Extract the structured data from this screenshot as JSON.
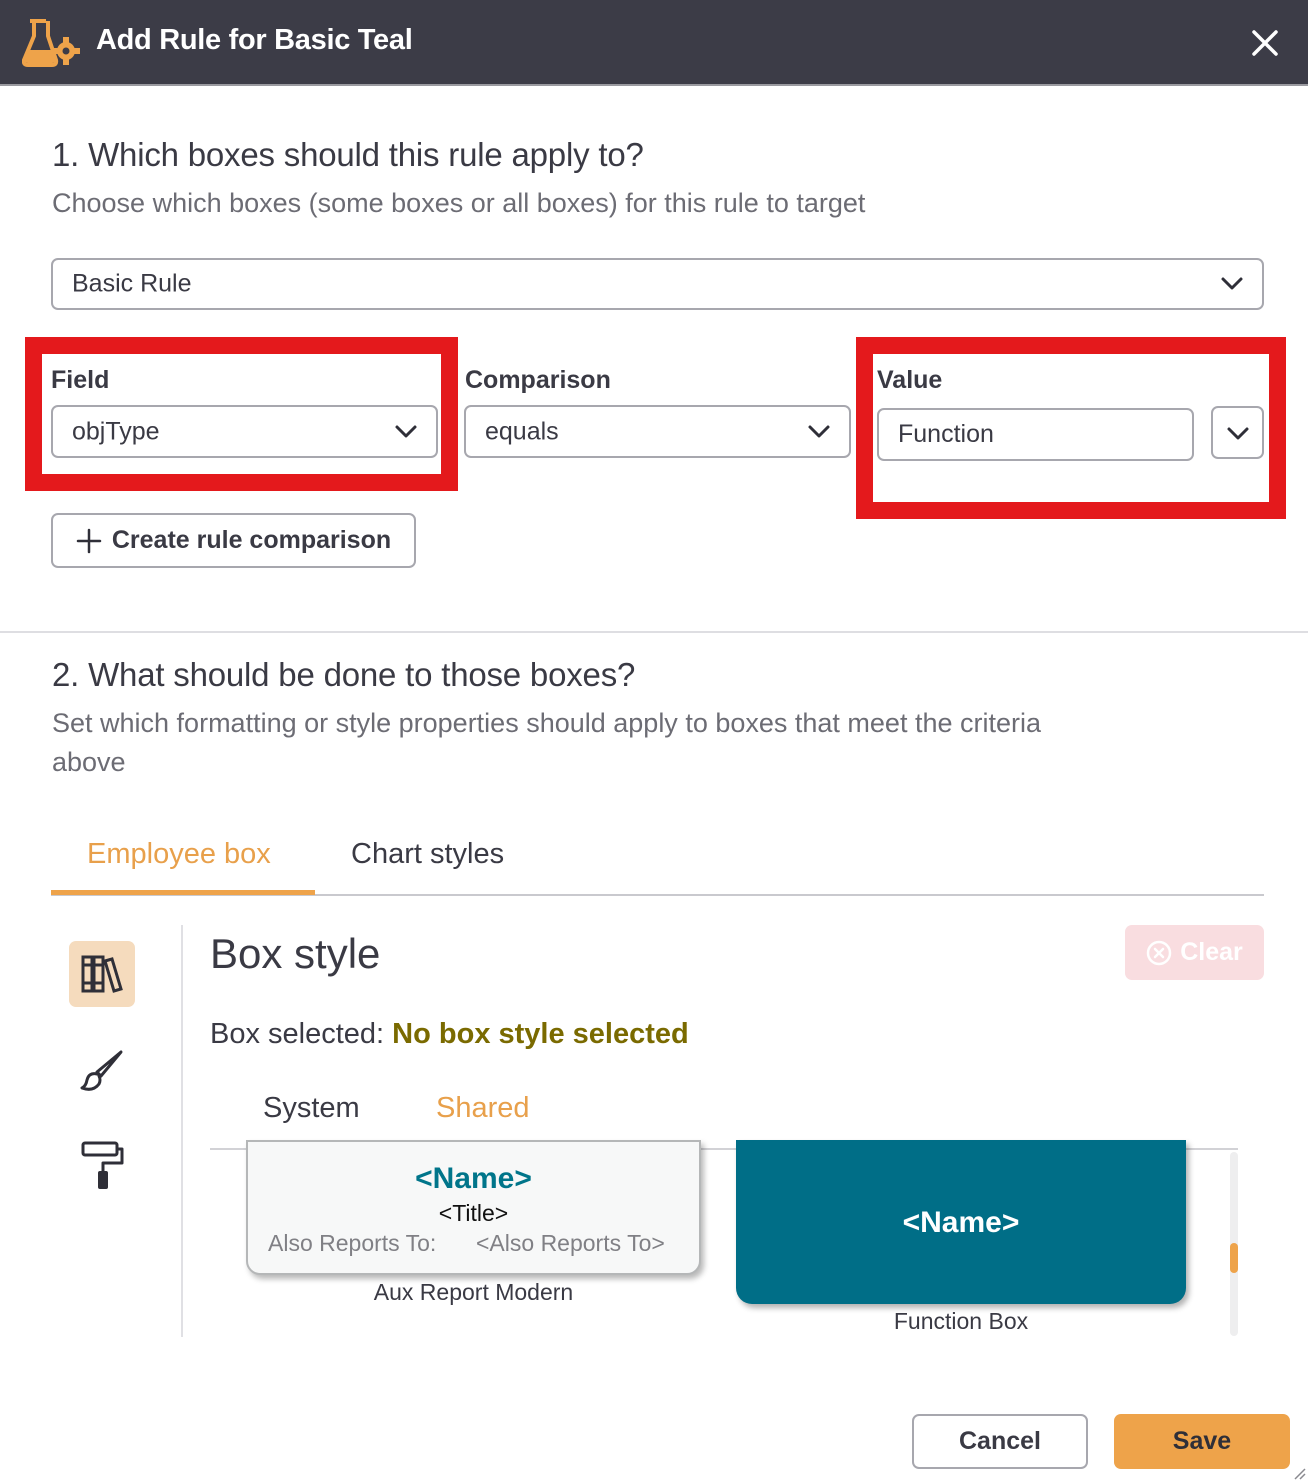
{
  "header": {
    "title": "Add Rule for Basic Teal",
    "icon": "flask-gear-icon",
    "close_icon": "close-icon"
  },
  "section1": {
    "title": "1. Which boxes should this rule apply to?",
    "subtitle": "Choose which boxes (some boxes or all boxes) for this rule to target",
    "rule_type": "Basic Rule",
    "field": {
      "label": "Field",
      "value": "objType"
    },
    "comparison": {
      "label": "Comparison",
      "value": "equals"
    },
    "value": {
      "label": "Value",
      "input": "Function"
    },
    "create_button": "Create rule comparison"
  },
  "section2": {
    "title": "2. What should be done to those boxes?",
    "subtitle_line1": "Set which formatting or style properties should apply to boxes that meet the criteria",
    "subtitle_line2": "above",
    "tabs": [
      {
        "label": "Employee box",
        "active": true
      },
      {
        "label": "Chart styles",
        "active": false
      }
    ]
  },
  "box_style": {
    "title": "Box style",
    "clear_label": "Clear",
    "selected_label": "Box selected:",
    "selected_value": "No box style selected",
    "subtabs": [
      {
        "label": "System",
        "active": false
      },
      {
        "label": "Shared",
        "active": true
      }
    ],
    "cards": [
      {
        "name": "<Name>",
        "title": "<Title>",
        "also_label": "Also Reports To:",
        "also_value": "<Also Reports To>",
        "caption": "Aux Report Modern"
      },
      {
        "name": "<Name>",
        "caption": "Function Box"
      }
    ]
  },
  "sidebar_icons": [
    "books-icon",
    "brush-icon",
    "paint-roller-icon"
  ],
  "footer": {
    "cancel": "Cancel",
    "save": "Save"
  },
  "colors": {
    "titlebar": "#3c3c47",
    "accent_orange": "#e8a04b",
    "highlight_red": "#e4191c",
    "teal": "#006e87",
    "selected_text": "#7a6a00"
  }
}
